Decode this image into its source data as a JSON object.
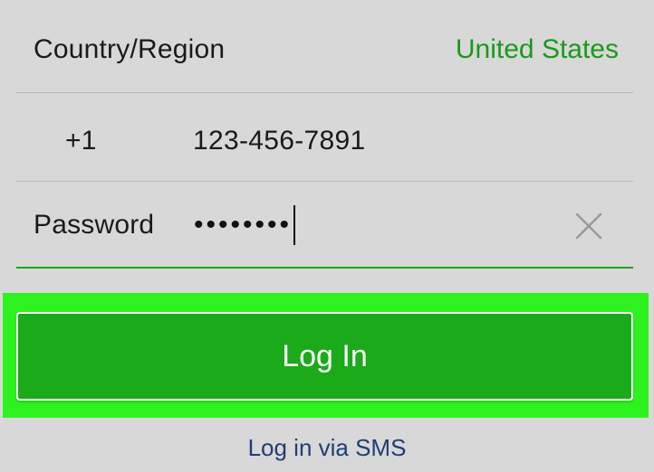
{
  "form": {
    "country_label": "Country/Region",
    "country_value": "United States",
    "phone_code": "+1",
    "phone_number": "123-456-7891",
    "password_label": "Password",
    "password_value": "••••••••"
  },
  "actions": {
    "login_label": "Log In",
    "sms_link_label": "Log in via SMS"
  },
  "icons": {
    "clear": "close-icon"
  },
  "colors": {
    "accent": "#1aa31a",
    "button": "#1aaa1a",
    "highlight": "#2df21f",
    "link": "#1f3e74",
    "background": "#d8d8d8"
  }
}
